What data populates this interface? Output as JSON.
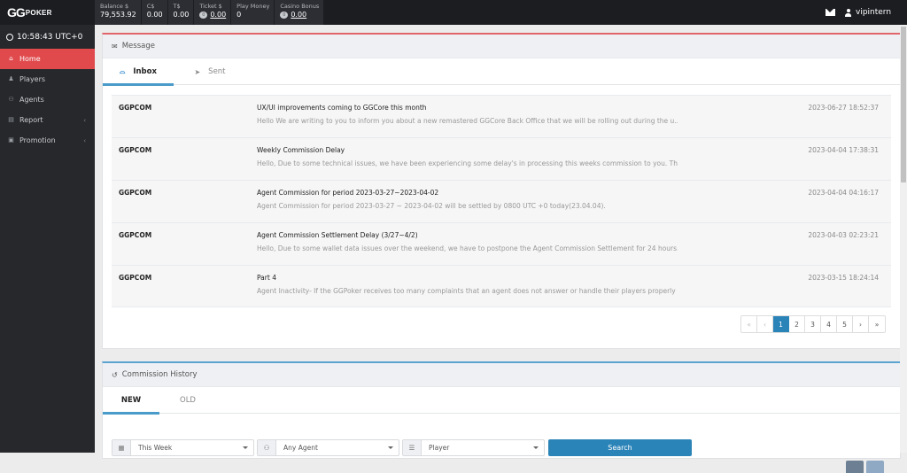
{
  "topbar": {
    "logo_gg": "GG",
    "logo_poker": "POKER",
    "balances": [
      {
        "label": "Balance $",
        "value": "79,553.92",
        "coin": false
      },
      {
        "label": "C$",
        "value": "0.00",
        "coin": false
      },
      {
        "label": "T$",
        "value": "0.00",
        "coin": false
      },
      {
        "label": "Ticket $",
        "value": "0.00",
        "coin": true,
        "coin_count": "0"
      },
      {
        "label": "Play Money",
        "value": "0",
        "coin": false
      },
      {
        "label": "Casino Bonus",
        "value": "0.00",
        "coin": true,
        "coin_count": "0"
      }
    ],
    "username": "vipintern"
  },
  "sidebar": {
    "clock": "10:58:43 UTC+0",
    "items": [
      {
        "label": "Home",
        "icon": "home-icon",
        "glyph": "⌂",
        "active": true,
        "has_children": false
      },
      {
        "label": "Players",
        "icon": "user-icon",
        "glyph": "♟",
        "active": false,
        "has_children": false
      },
      {
        "label": "Agents",
        "icon": "users-icon",
        "glyph": "⚇",
        "active": false,
        "has_children": false
      },
      {
        "label": "Report",
        "icon": "report-icon",
        "glyph": "▤",
        "active": false,
        "has_children": true
      },
      {
        "label": "Promotion",
        "icon": "gift-icon",
        "glyph": "▣",
        "active": false,
        "has_children": true
      }
    ]
  },
  "message_panel": {
    "title": "Message",
    "tabs": [
      {
        "label": "Inbox",
        "active": true
      },
      {
        "label": "Sent",
        "active": false
      }
    ],
    "messages": [
      {
        "from": "GGPCOM",
        "subject": "UX/UI improvements coming to GGCore this month",
        "preview": "Hello       We are writing to you to inform you about a new remastered GGCore Back Office that we will be rolling out during the u...",
        "date": "2023-06-27 18:52:37"
      },
      {
        "from": "GGPCOM",
        "subject": "Weekly Commission Delay",
        "preview": "Hello,      Due to some technical issues, we have been experiencing some delay's in processing this weeks commission to you. This h...",
        "date": "2023-04-04 17:38:31"
      },
      {
        "from": "GGPCOM",
        "subject": "Agent Commission for period 2023-03-27~2023-04-02",
        "preview": "Agent Commission for period 2023-03-27 ~ 2023-04-02 will be settled by 0800 UTC +0 today(23.04.04).",
        "date": "2023-04-04 04:16:17"
      },
      {
        "from": "GGPCOM",
        "subject": "Agent Commission Settlement Delay (3/27~4/2)",
        "preview": "Hello,     Due to some wallet data issues over the weekend, we have to postpone the Agent Commission Settlement for 24 hours.    ...",
        "date": "2023-04-03 02:23:21"
      },
      {
        "from": "GGPCOM",
        "subject": "Part 4",
        "preview": " Agent Inactivity-   If the GGPoker receives too many complaints that an agent does not answer or handle their players properly whil...",
        "date": "2023-03-15 18:24:14"
      }
    ],
    "pagination": {
      "first": "«",
      "prev": "‹",
      "next": "›",
      "last": "»",
      "pages": [
        "1",
        "2",
        "3",
        "4",
        "5"
      ],
      "current": "1"
    }
  },
  "commission_panel": {
    "title": "Commission History",
    "tabs": [
      {
        "label": "NEW",
        "active": true
      },
      {
        "label": "OLD",
        "active": false
      }
    ],
    "filters": {
      "period": "This Week",
      "agent": "Any Agent",
      "type": "Player"
    },
    "search_label": "Search"
  }
}
